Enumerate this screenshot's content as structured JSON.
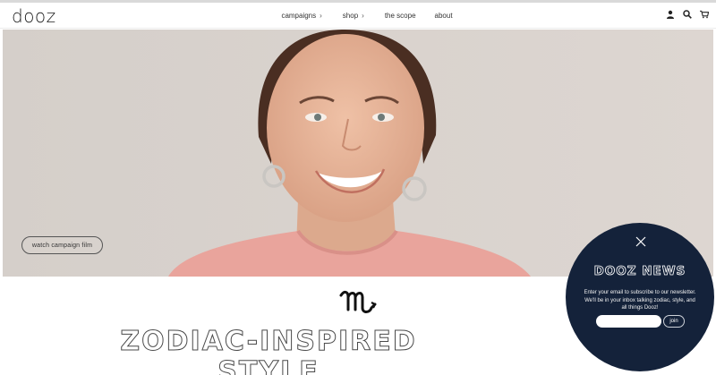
{
  "brand": {
    "logo_text": "dooz"
  },
  "nav": {
    "items": [
      {
        "label": "campaigns",
        "has_dropdown": true
      },
      {
        "label": "shop",
        "has_dropdown": true
      },
      {
        "label": "the scope",
        "has_dropdown": false
      },
      {
        "label": "about",
        "has_dropdown": false
      }
    ],
    "chevron": "›"
  },
  "header_icons": [
    "account-icon",
    "search-icon",
    "cart-icon"
  ],
  "hero": {
    "watch_button": "watch campaign film"
  },
  "section": {
    "symbol": "scorpio-glyph",
    "headline_line1": "ZODIAC-INSPIRED",
    "headline_line2": "STYLE"
  },
  "popup": {
    "title": "DOOZ NEWS",
    "body": "Enter your email to subscribe to our newsletter. We'll be in your inbox talking zodiac, style, and all things Dooz!",
    "input_placeholder": "",
    "join_label": "join",
    "bg_color": "#14223a"
  }
}
